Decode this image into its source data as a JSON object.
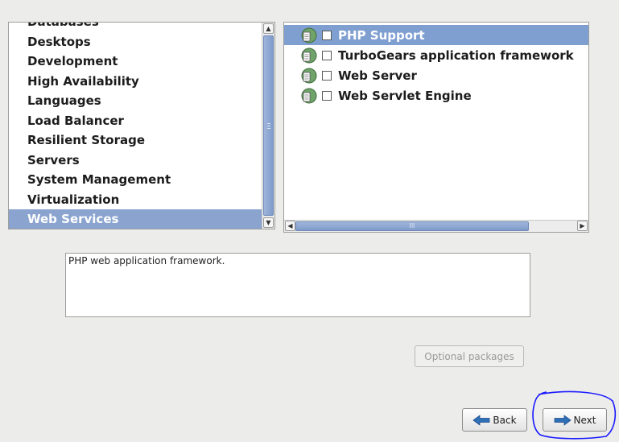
{
  "groups": {
    "items": [
      {
        "label": "Databases"
      },
      {
        "label": "Desktops"
      },
      {
        "label": "Development"
      },
      {
        "label": "High Availability"
      },
      {
        "label": "Languages"
      },
      {
        "label": "Load Balancer"
      },
      {
        "label": "Resilient Storage"
      },
      {
        "label": "Servers"
      },
      {
        "label": "System Management"
      },
      {
        "label": "Virtualization"
      },
      {
        "label": "Web Services",
        "selected": true
      }
    ],
    "scroll_grip": "≡"
  },
  "packages": {
    "items": [
      {
        "label": "PHP Support",
        "checked": false,
        "selected": true,
        "icon": "package-icon"
      },
      {
        "label": "TurboGears application framework",
        "checked": false,
        "icon": "package-icon"
      },
      {
        "label": "Web Server",
        "checked": false,
        "icon": "package-icon"
      },
      {
        "label": "Web Servlet Engine",
        "checked": false,
        "icon": "package-icon"
      }
    ],
    "hscroll_grip": "III"
  },
  "description": "PHP web application framework.",
  "buttons": {
    "optional_packages": "Optional packages",
    "back": "Back",
    "next": "Next"
  },
  "colors": {
    "selection": "#8aa4cf",
    "annotation_circle": "#1a1aff"
  }
}
